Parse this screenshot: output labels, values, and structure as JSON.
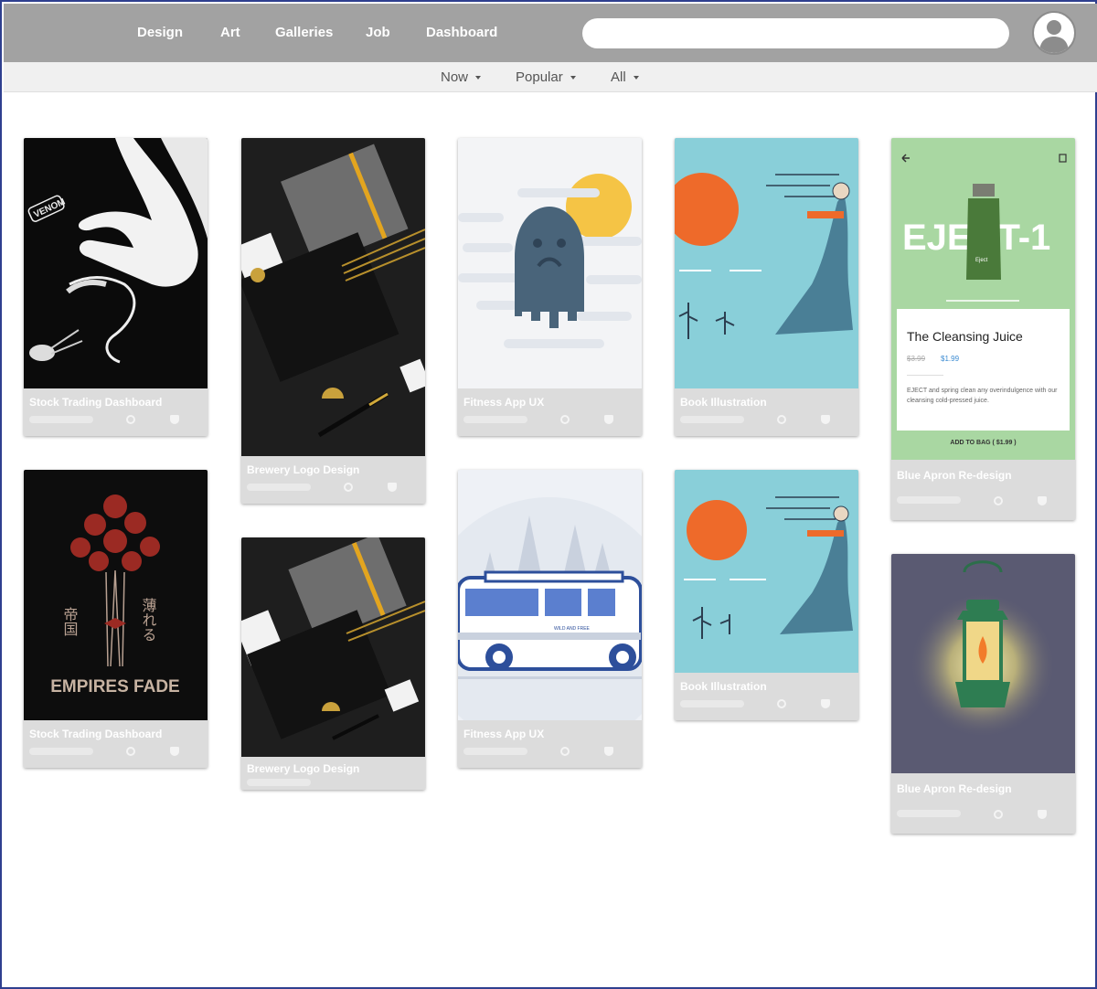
{
  "nav": {
    "items": [
      {
        "label": "Design"
      },
      {
        "label": "Art"
      },
      {
        "label": "Galleries"
      },
      {
        "label": "Job"
      },
      {
        "label": "Dashboard"
      }
    ]
  },
  "search": {
    "value": "",
    "placeholder": ""
  },
  "filters": [
    {
      "label": "Now"
    },
    {
      "label": "Popular"
    },
    {
      "label": "All"
    }
  ],
  "cards": {
    "stock_1": {
      "title": "Stock Trading Dashboard"
    },
    "stock_2": {
      "title": "Stock Trading Dashboard"
    },
    "brewery_1": {
      "title": "Brewery Logo Design"
    },
    "brewery_2": {
      "title": "Brewery Logo Design"
    },
    "fitness_1": {
      "title": "Fitness App UX"
    },
    "fitness_2": {
      "title": "Fitness App UX"
    },
    "book_1": {
      "title": "Book Illustration"
    },
    "book_2": {
      "title": "Book Illustration"
    },
    "apron_1": {
      "title": "Blue Apron Re-design"
    },
    "apron_2": {
      "title": "Blue Apron Re-design"
    }
  },
  "artwork": {
    "venom_text": "VENOM",
    "empires_text": "EMPIRES FADE",
    "kanji_left": "帝国",
    "kanji_right": "薄れる",
    "van_text": "WILD AND FREE",
    "eject_title": "EJECT-1",
    "bottle_label": "Eject",
    "juice_name": "The Cleansing Juice",
    "old_price": "$3.99",
    "new_price": "$1.99",
    "juice_desc": "EJECT and spring clean any overindulgence with our cleansing cold-pressed juice.",
    "add_to_bag": "ADD TO BAG ( $1.99 )"
  },
  "colors": {
    "topbar": "#a2a2a2",
    "subbar": "#f0f0f0",
    "frame_border": "#2f3f8f",
    "card_footer": "#dcdcdc",
    "juice_green": "#a9d7a2",
    "sky_blue": "#89cfd9",
    "sun_orange": "#ee6a2a",
    "lantern_bg": "#5a5a72"
  }
}
